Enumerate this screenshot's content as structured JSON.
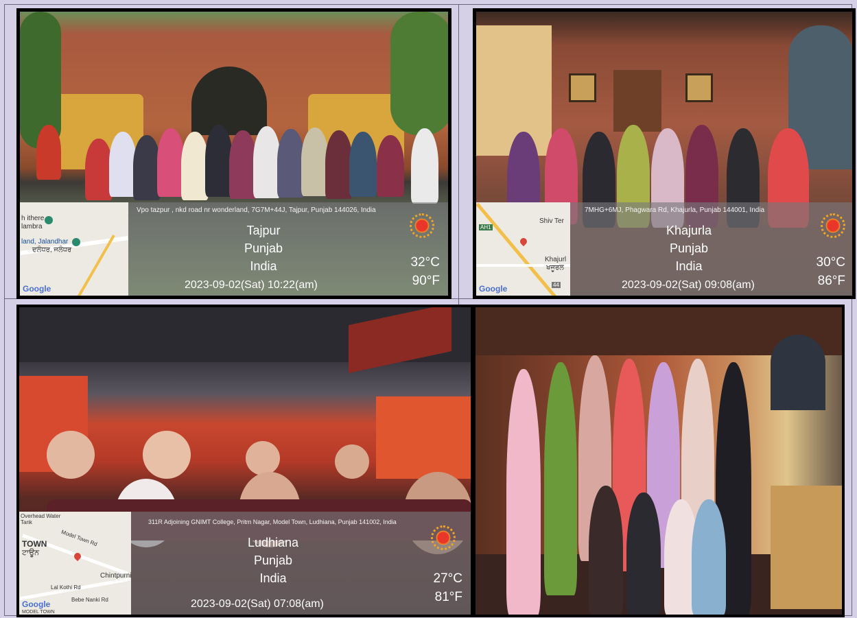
{
  "photos": [
    {
      "address": "Vpo tazpur , nkd road nr wonderland, 7G7M+44J, Tajpur, Punjab 144026, India",
      "city": "Tajpur",
      "state": "Punjab",
      "country": "India",
      "temp_c": "32°C",
      "temp_f": "90°F",
      "datetime": "2023-09-02(Sat)   10:22(am)",
      "map_labels": [
        "h ithere",
        "lambra",
        "land, Jalandhar",
        "ਦਲੰਧਰ, ਜਲੰਧਰ"
      ],
      "google": "Google"
    },
    {
      "address": "7MHG+6MJ, Phagwara Rd, Khajurla, Punjab 144001, India",
      "city": "Khajurla",
      "state": "Punjab",
      "country": "India",
      "temp_c": "30°C",
      "temp_f": "86°F",
      "datetime": "2023-09-02(Sat)   09:08(am)",
      "map_labels": [
        "Shiv Ter",
        "Khajurl",
        "ਖਜੂਰਲ",
        "AH1",
        "44"
      ],
      "google": "Google"
    },
    {
      "address": "311R Adjoining GNIMT College, Pritm Nagar, Model Town, Ludhiana, Punjab 141002, India",
      "city": "Ludhiana",
      "state": "Punjab",
      "country": "India",
      "temp_c": "27°C",
      "temp_f": "81°F",
      "datetime": "2023-09-02(Sat)   07:08(am)",
      "map_labels": [
        "Overhead Water Tank",
        "TOWN",
        "ਟਾਊਨ",
        "Model Town Rd",
        "Chintpurni M",
        "Lal Kothi Rd",
        "Bebe Nanki Rd",
        "MODEL TOWN"
      ],
      "google": "Google"
    }
  ],
  "colors": {
    "background": "#d6d0e6",
    "overlay": "#78787d",
    "sun": "#e8362a"
  }
}
